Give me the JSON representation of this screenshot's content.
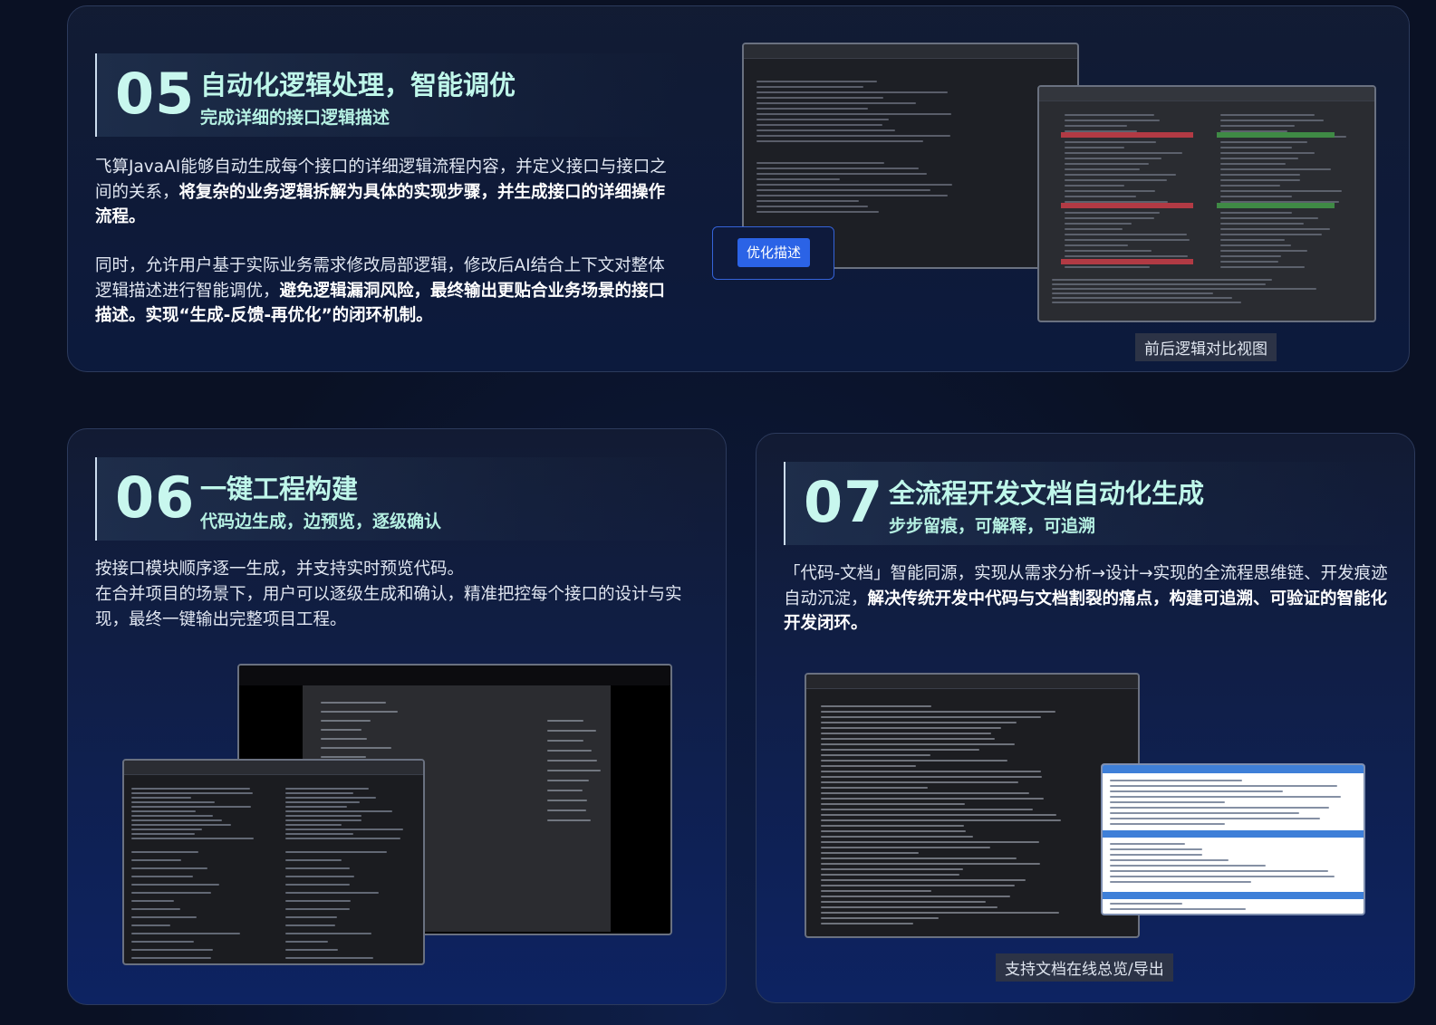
{
  "sections": {
    "s05": {
      "num": "05",
      "title": "自动化逻辑处理，智能调优",
      "subtitle": "完成详细的接口逻辑描述",
      "p1_a": "飞算JavaAI能够自动生成每个接口的详细逻辑流程内容，并定义接口与接口之间的关系，",
      "p1_b": "将复杂的业务逻辑拆解为具体的实现步骤，并生成接口的详细操作流程。",
      "p2_a": "同时，允许用户基于实际业务需求修改局部逻辑，修改后AI结合上下文对整体逻辑描述进行智能调优，",
      "p2_b": "避免逻辑漏洞风险，最终输出更贴合业务场景的接口描述。实现“生成-反馈-再优化”的闭环机制。",
      "button": "优化描述",
      "caption": "前后逻辑对比视图"
    },
    "s06": {
      "num": "06",
      "title": "一键工程构建",
      "subtitle": "代码边生成，边预览，逐级确认",
      "p1": "按接口模块顺序逐一生成，并支持实时预览代码。",
      "p2": "在合并项目的场景下，用户可以逐级生成和确认，精准把控每个接口的设计与实现，最终一键输出完整项目工程。"
    },
    "s07": {
      "num": "07",
      "title": "全流程开发文档自动化生成",
      "subtitle": "步步留痕，可解释，可追溯",
      "p1_a": "「代码-文档」智能同源，实现从需求分析→设计→实现的全流程思维链、开发痕迹自动沉淀，",
      "p1_b": "解决传统开发中代码与文档割裂的痛点，构建可追溯、可验证的智能化开发闭环。",
      "caption": "支持文档在线总览/导出"
    }
  },
  "colors": {
    "accent_title": "#bff7ea",
    "number": "#c8f7ee",
    "button": "#2b63e6",
    "diff_removed": "#b23a44",
    "diff_added": "#3f8a45"
  }
}
